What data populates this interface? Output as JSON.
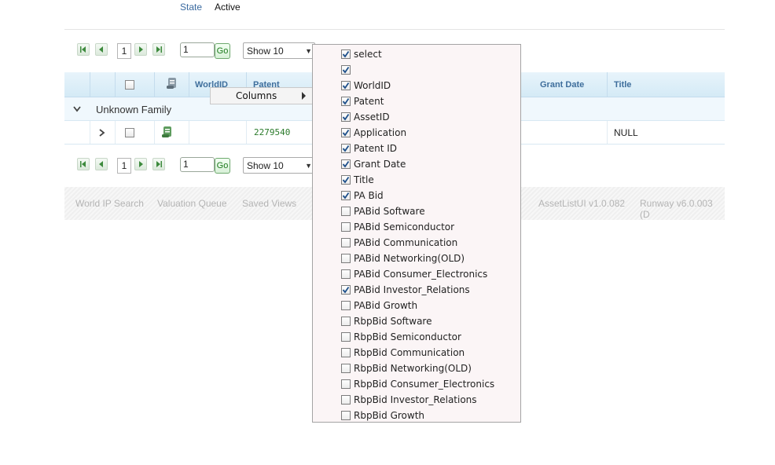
{
  "state": {
    "label": "State",
    "value": "Active"
  },
  "pager": {
    "page": "1",
    "goto_value": "1",
    "go_label": "Go",
    "show_label": "Show 10"
  },
  "grid": {
    "headers": [
      "WorldID",
      "Patent",
      "Grant Date",
      "Title"
    ],
    "group_label": "Unknown Family",
    "row": {
      "patent": "2279540",
      "title": "NULL"
    }
  },
  "footer": {
    "links": [
      "World IP Search",
      "Valuation Queue",
      "Saved Views"
    ],
    "versions": [
      "AssetListUI v1.0.082",
      "Runway v6.0.003 (D"
    ]
  },
  "context_menu": {
    "columns_label": "Columns"
  },
  "columns_menu": {
    "items": [
      {
        "label": "select",
        "checked": true
      },
      {
        "label": "",
        "checked": true
      },
      {
        "label": "WorldID",
        "checked": true
      },
      {
        "label": "Patent",
        "checked": true
      },
      {
        "label": "AssetID",
        "checked": true
      },
      {
        "label": "Application",
        "checked": true
      },
      {
        "label": "Patent ID",
        "checked": true
      },
      {
        "label": "Grant Date",
        "checked": true
      },
      {
        "label": "Title",
        "checked": true
      },
      {
        "label": "PA Bid",
        "checked": true
      },
      {
        "label": "PABid Software",
        "checked": false
      },
      {
        "label": "PABid Semiconductor",
        "checked": false
      },
      {
        "label": "PABid Communication",
        "checked": false
      },
      {
        "label": "PABid Networking(OLD)",
        "checked": false
      },
      {
        "label": "PABid Consumer_Electronics",
        "checked": false
      },
      {
        "label": "PABid Investor_Relations",
        "checked": true
      },
      {
        "label": "PABid Growth",
        "checked": false
      },
      {
        "label": "RbpBid Software",
        "checked": false
      },
      {
        "label": "RbpBid Semiconductor",
        "checked": false
      },
      {
        "label": "RbpBid Communication",
        "checked": false
      },
      {
        "label": "RbpBid Networking(OLD)",
        "checked": false
      },
      {
        "label": "RbpBid Consumer_Electronics",
        "checked": false
      },
      {
        "label": "RbpBid Investor_Relations",
        "checked": false
      },
      {
        "label": "RbpBid Growth",
        "checked": false
      }
    ]
  },
  "colors": {
    "accent_blue": "#3e6e9c",
    "go_green": "#1d7a1d",
    "patent_link": "#2a7a2a"
  }
}
